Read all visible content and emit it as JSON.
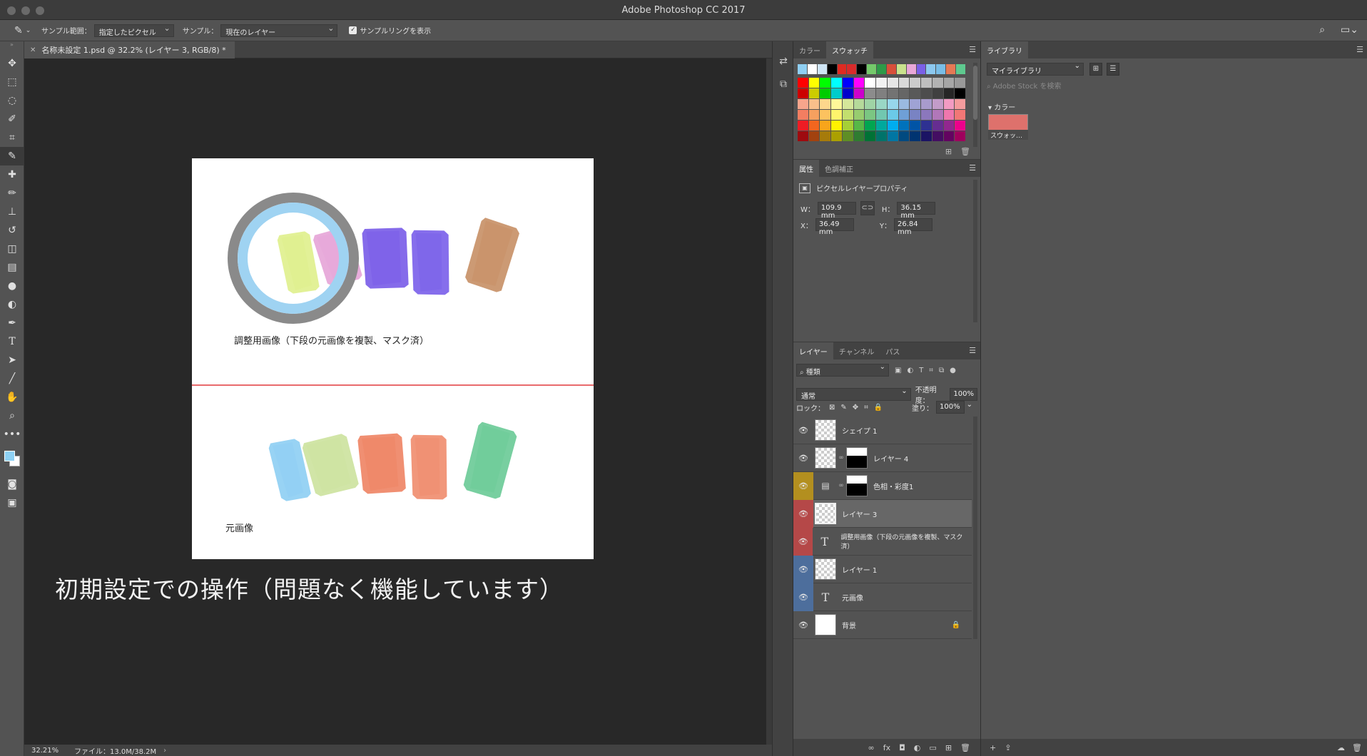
{
  "window": {
    "title": "Adobe Photoshop CC 2017"
  },
  "options_bar": {
    "tool_icon": "eyedropper-icon",
    "sample_size_label": "サンプル範囲：",
    "sample_size_value": "指定したピクセル",
    "sample_label": "サンプル：",
    "sample_value": "現在のレイヤー",
    "show_ring_label": "サンプルリングを表示",
    "show_ring_checked": true,
    "icons": [
      "search-icon",
      "workspace-icon"
    ]
  },
  "tools": [
    "move-icon",
    "marquee-icon",
    "lasso-icon",
    "quick-select-icon",
    "crop-icon",
    "eyedropper-icon",
    "healing-brush-icon",
    "brush-icon",
    "clone-stamp-icon",
    "history-brush-icon",
    "eraser-icon",
    "gradient-icon",
    "blur-icon",
    "dodge-icon",
    "pen-icon",
    "type-icon",
    "path-select-icon",
    "line-icon",
    "hand-icon",
    "zoom-icon",
    "more-tools-icon"
  ],
  "colors": {
    "foreground": "#8ed1f4",
    "background": "#ffffff",
    "guide_line": "#e0383c",
    "ring_gray": "#8a8a8a",
    "ring_blue": "#9fd3f2"
  },
  "document": {
    "tab_title": "名称未設定 1.psd @ 32.2% (レイヤー 3, RGB/8) *",
    "caption_top": "調整用画像（下段の元画像を複製、マスク済）",
    "caption_bottom": "元画像",
    "overlay_caption": "初期設定での操作（問題なく機能しています）",
    "top_strokes": [
      "#dff08e",
      "#e6a6d8",
      "#7b5ee8",
      "#7c62ea",
      "#c89168"
    ],
    "bottom_strokes": [
      "#8fcff3",
      "#cde3a0",
      "#ef8566",
      "#f08e70",
      "#6ccb98"
    ]
  },
  "status": {
    "zoom": "32.21%",
    "file": "ファイル：13.0M/38.2M",
    "arrow": "›"
  },
  "swatches_panel": {
    "tabs": [
      "カラー",
      "スウォッチ"
    ],
    "active_tab": "スウォッチ",
    "recent": [
      "#8fcff3",
      "#ffffff",
      "#cfe5f5",
      "#000000",
      "#de2b22",
      "#d82b2b",
      "#000000",
      "#74c96a",
      "#2e9a48",
      "#d94f3a",
      "#c9e28d",
      "#e8a7d8",
      "#7a60e6",
      "#8cc8ef",
      "#79bde6",
      "#e57955",
      "#5ec98f"
    ],
    "rows": [
      [
        "#ff0000",
        "#ffff00",
        "#00ff00",
        "#00ffff",
        "#0000ff",
        "#ff00ff",
        "#ffffff",
        "#f2f2f2",
        "#e6e6e6",
        "#d9d9d9",
        "#cccccc",
        "#bfbfbf",
        "#b3b3b3",
        "#a6a6a6",
        "#999999"
      ],
      [
        "#cc0000",
        "#cccc00",
        "#00cc00",
        "#00cccc",
        "#0000cc",
        "#cc00cc",
        "#8c8c8c",
        "#808080",
        "#737373",
        "#666666",
        "#595959",
        "#4d4d4d",
        "#404040",
        "#262626",
        "#000000"
      ],
      [
        "#f7a58c",
        "#f9bf8b",
        "#fdd78c",
        "#fff799",
        "#d5e79a",
        "#b5d99a",
        "#9fd3a5",
        "#99d6c5",
        "#97d7ec",
        "#9ab9e0",
        "#9fa3d4",
        "#a89bcd",
        "#c39cc9",
        "#f29bc3",
        "#f49b9d"
      ],
      [
        "#f37e61",
        "#f6a05f",
        "#fcc25f",
        "#fff36c",
        "#c3df6e",
        "#97cc6f",
        "#7bc682",
        "#71c7b0",
        "#6bc9e8",
        "#6f9fd6",
        "#7983c3",
        "#8b77bc",
        "#b177b9",
        "#ef77ad",
        "#f27776"
      ],
      [
        "#ee1c24",
        "#f2661f",
        "#f8a51b",
        "#fff200",
        "#a6d036",
        "#57b847",
        "#00a651",
        "#00a99d",
        "#00adef",
        "#0072bc",
        "#0054a6",
        "#2e3192",
        "#662d91",
        "#92278f",
        "#ec008c"
      ],
      [
        "#9e0b0f",
        "#a2420f",
        "#a67b0b",
        "#aba000",
        "#5f8e25",
        "#2f7c31",
        "#007236",
        "#00736a",
        "#0076a3",
        "#004a80",
        "#003471",
        "#1b1464",
        "#440e62",
        "#630460",
        "#9e005d"
      ]
    ]
  },
  "properties_panel": {
    "tabs": [
      "属性",
      "色調補正"
    ],
    "active_tab": "属性",
    "header": "ピクセルレイヤープロパティ",
    "w_label": "W：",
    "w_value": "109.9 mm",
    "h_label": "H：",
    "h_value": "36.15 mm",
    "x_label": "X：",
    "x_value": "36.49 mm",
    "y_label": "Y：",
    "y_value": "26.84 mm"
  },
  "layers_panel": {
    "tabs": [
      "レイヤー",
      "チャンネル",
      "パス"
    ],
    "active_tab": "レイヤー",
    "kind_filter": "種類",
    "blend_mode": "通常",
    "opacity_label": "不透明度：",
    "opacity": "100%",
    "lock_label": "ロック：",
    "fill_label": "塗り：",
    "fill": "100%",
    "layers": [
      {
        "name": "シェイプ 1",
        "type": "shape",
        "tag": ""
      },
      {
        "name": "レイヤー 4",
        "type": "masked",
        "tag": ""
      },
      {
        "name": "色相・彩度1",
        "type": "adjustment",
        "tag": "#b38f1f"
      },
      {
        "name": "レイヤー 3",
        "type": "pixel",
        "tag": "#b54848",
        "selected": true
      },
      {
        "name": "調整用画像（下段の元画像を複製、マスク済）",
        "type": "text",
        "tag": "#b54848"
      },
      {
        "name": "レイヤー 1",
        "type": "pixel",
        "tag": "#4d6e9c"
      },
      {
        "name": "元画像",
        "type": "text",
        "tag": "#4d6e9c"
      },
      {
        "name": "背景",
        "type": "background",
        "tag": "",
        "locked": true
      }
    ]
  },
  "library_panel": {
    "tab": "ライブラリ",
    "library_name": "マイライブラリ",
    "search_placeholder": "Adobe Stock を検索",
    "section": "カラー",
    "swatch_label": "スウォッ…",
    "swatch_color": "#de716c"
  }
}
